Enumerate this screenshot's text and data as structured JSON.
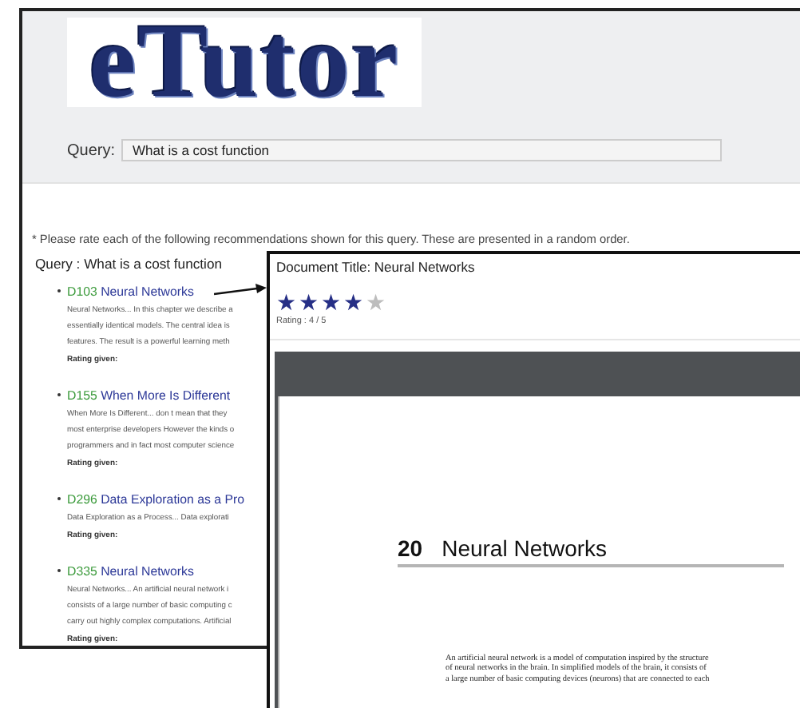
{
  "logo": "eTutor",
  "query": {
    "label": "Query:",
    "value": "What is a cost function"
  },
  "instruction": "* Please rate each of the following recommendations shown for this query. These are presented in a random order.",
  "list_heading": "Query : What is a cost function",
  "recommendations": [
    {
      "id": "D103",
      "title": "Neural Networks",
      "snippet": [
        "Neural Networks... In this chapter we describe a",
        "essentially identical models. The central idea is",
        "features. The result is a powerful learning meth"
      ],
      "rating_label": "Rating given:"
    },
    {
      "id": "D155",
      "title": "When More Is Different",
      "snippet": [
        "When More Is Different... don t mean that they",
        "most enterprise developers However the kinds o",
        "programmers and in fact most computer science"
      ],
      "rating_label": "Rating given:"
    },
    {
      "id": "D296",
      "title": "Data Exploration as a Pro",
      "snippet": [
        "Data Exploration as a Process... Data explorati"
      ],
      "rating_label": "Rating given:"
    },
    {
      "id": "D335",
      "title": "Neural Networks",
      "snippet": [
        "Neural Networks... An artificial neural network i",
        "consists of a large number of basic computing c",
        "carry out highly complex computations. Artificial"
      ],
      "rating_label": "Rating given:"
    }
  ],
  "viewer": {
    "document_title": "Document Title: Neural Networks",
    "stars": 4,
    "rating": "Rating : 4 / 5",
    "chapter_number": "20",
    "chapter_title": "Neural Networks",
    "body": [
      "An artificial neural network is a model of computation inspired by the structure",
      "of neural networks in the brain. In simplified models of the brain, it consists of",
      "a large number of basic computing devices (neurons) that are connected to each"
    ]
  }
}
